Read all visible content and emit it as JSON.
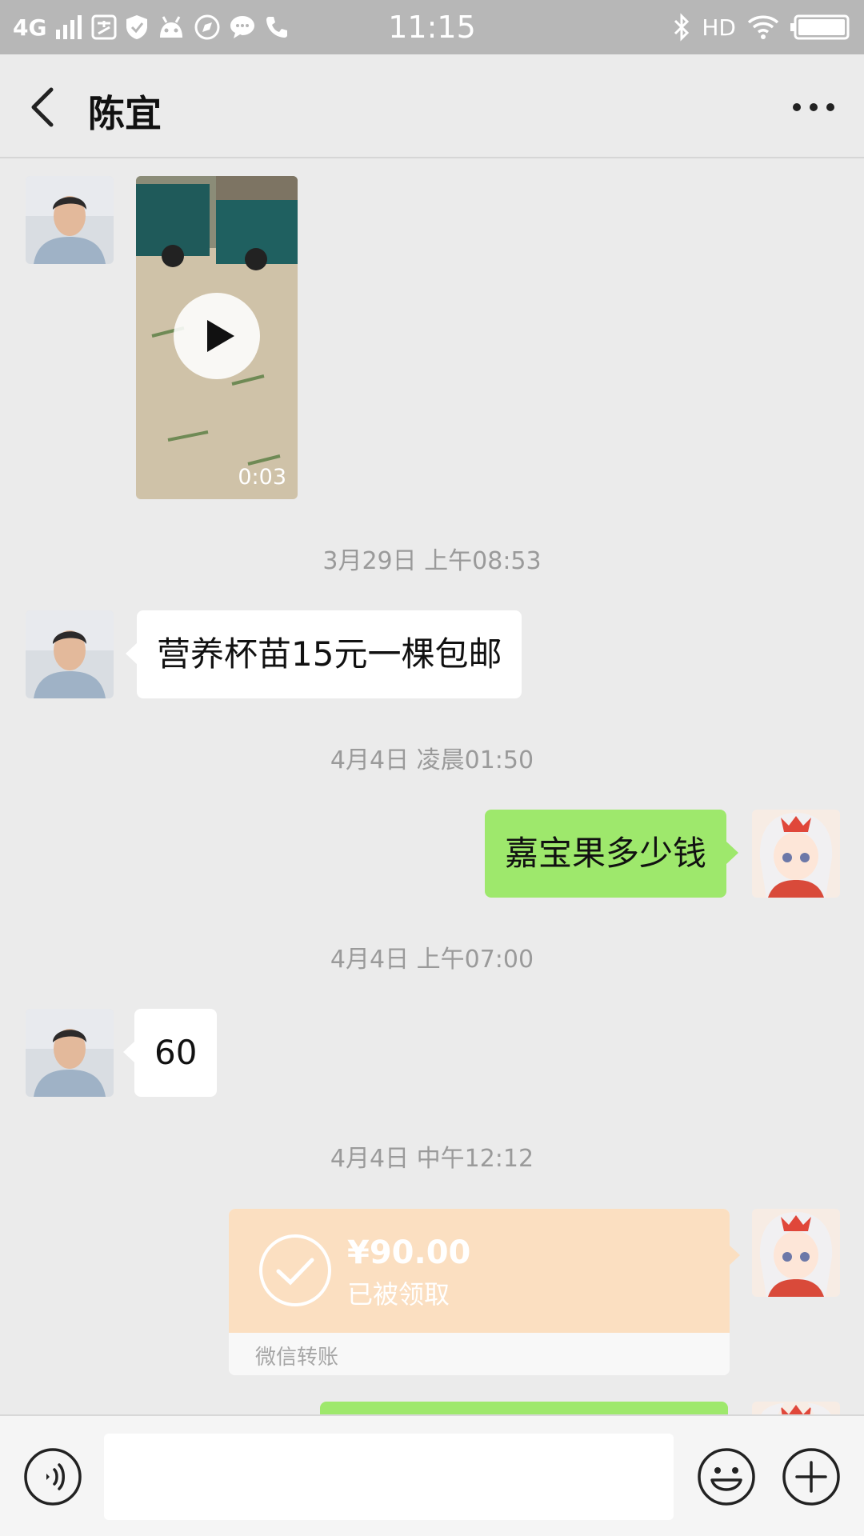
{
  "status_bar": {
    "network": "4G",
    "time": "11:15",
    "hd": "HD"
  },
  "header": {
    "title": "陈宜"
  },
  "messages": {
    "video_duration": "0:03",
    "time1": "3月29日 上午08:53",
    "msg1": "营养杯苗15元一棵包邮",
    "time2": "4月4日 凌晨01:50",
    "msg2": "嘉宝果多少钱",
    "time3": "4月4日 上午07:00",
    "msg3": "60",
    "time4": "4月4日 中午12:12",
    "transfer": {
      "amount": "¥90.00",
      "status": "已被领取",
      "label": "微信转账"
    }
  },
  "input": {
    "placeholder": ""
  },
  "colors": {
    "status_bar": "#b7b7b7",
    "background": "#ebebeb",
    "outgoing_bubble": "#9ee86c",
    "transfer_card": "#fbdfc1"
  },
  "icons": [
    "signal-icon",
    "alipay-icon",
    "shield-icon",
    "android-icon",
    "compass-icon",
    "chat-icon",
    "phone-icon",
    "bluetooth-icon",
    "wifi-icon",
    "battery-icon",
    "back-arrow-icon",
    "more-dots-icon",
    "play-icon",
    "check-icon",
    "voice-icon",
    "emoji-icon",
    "plus-icon"
  ]
}
